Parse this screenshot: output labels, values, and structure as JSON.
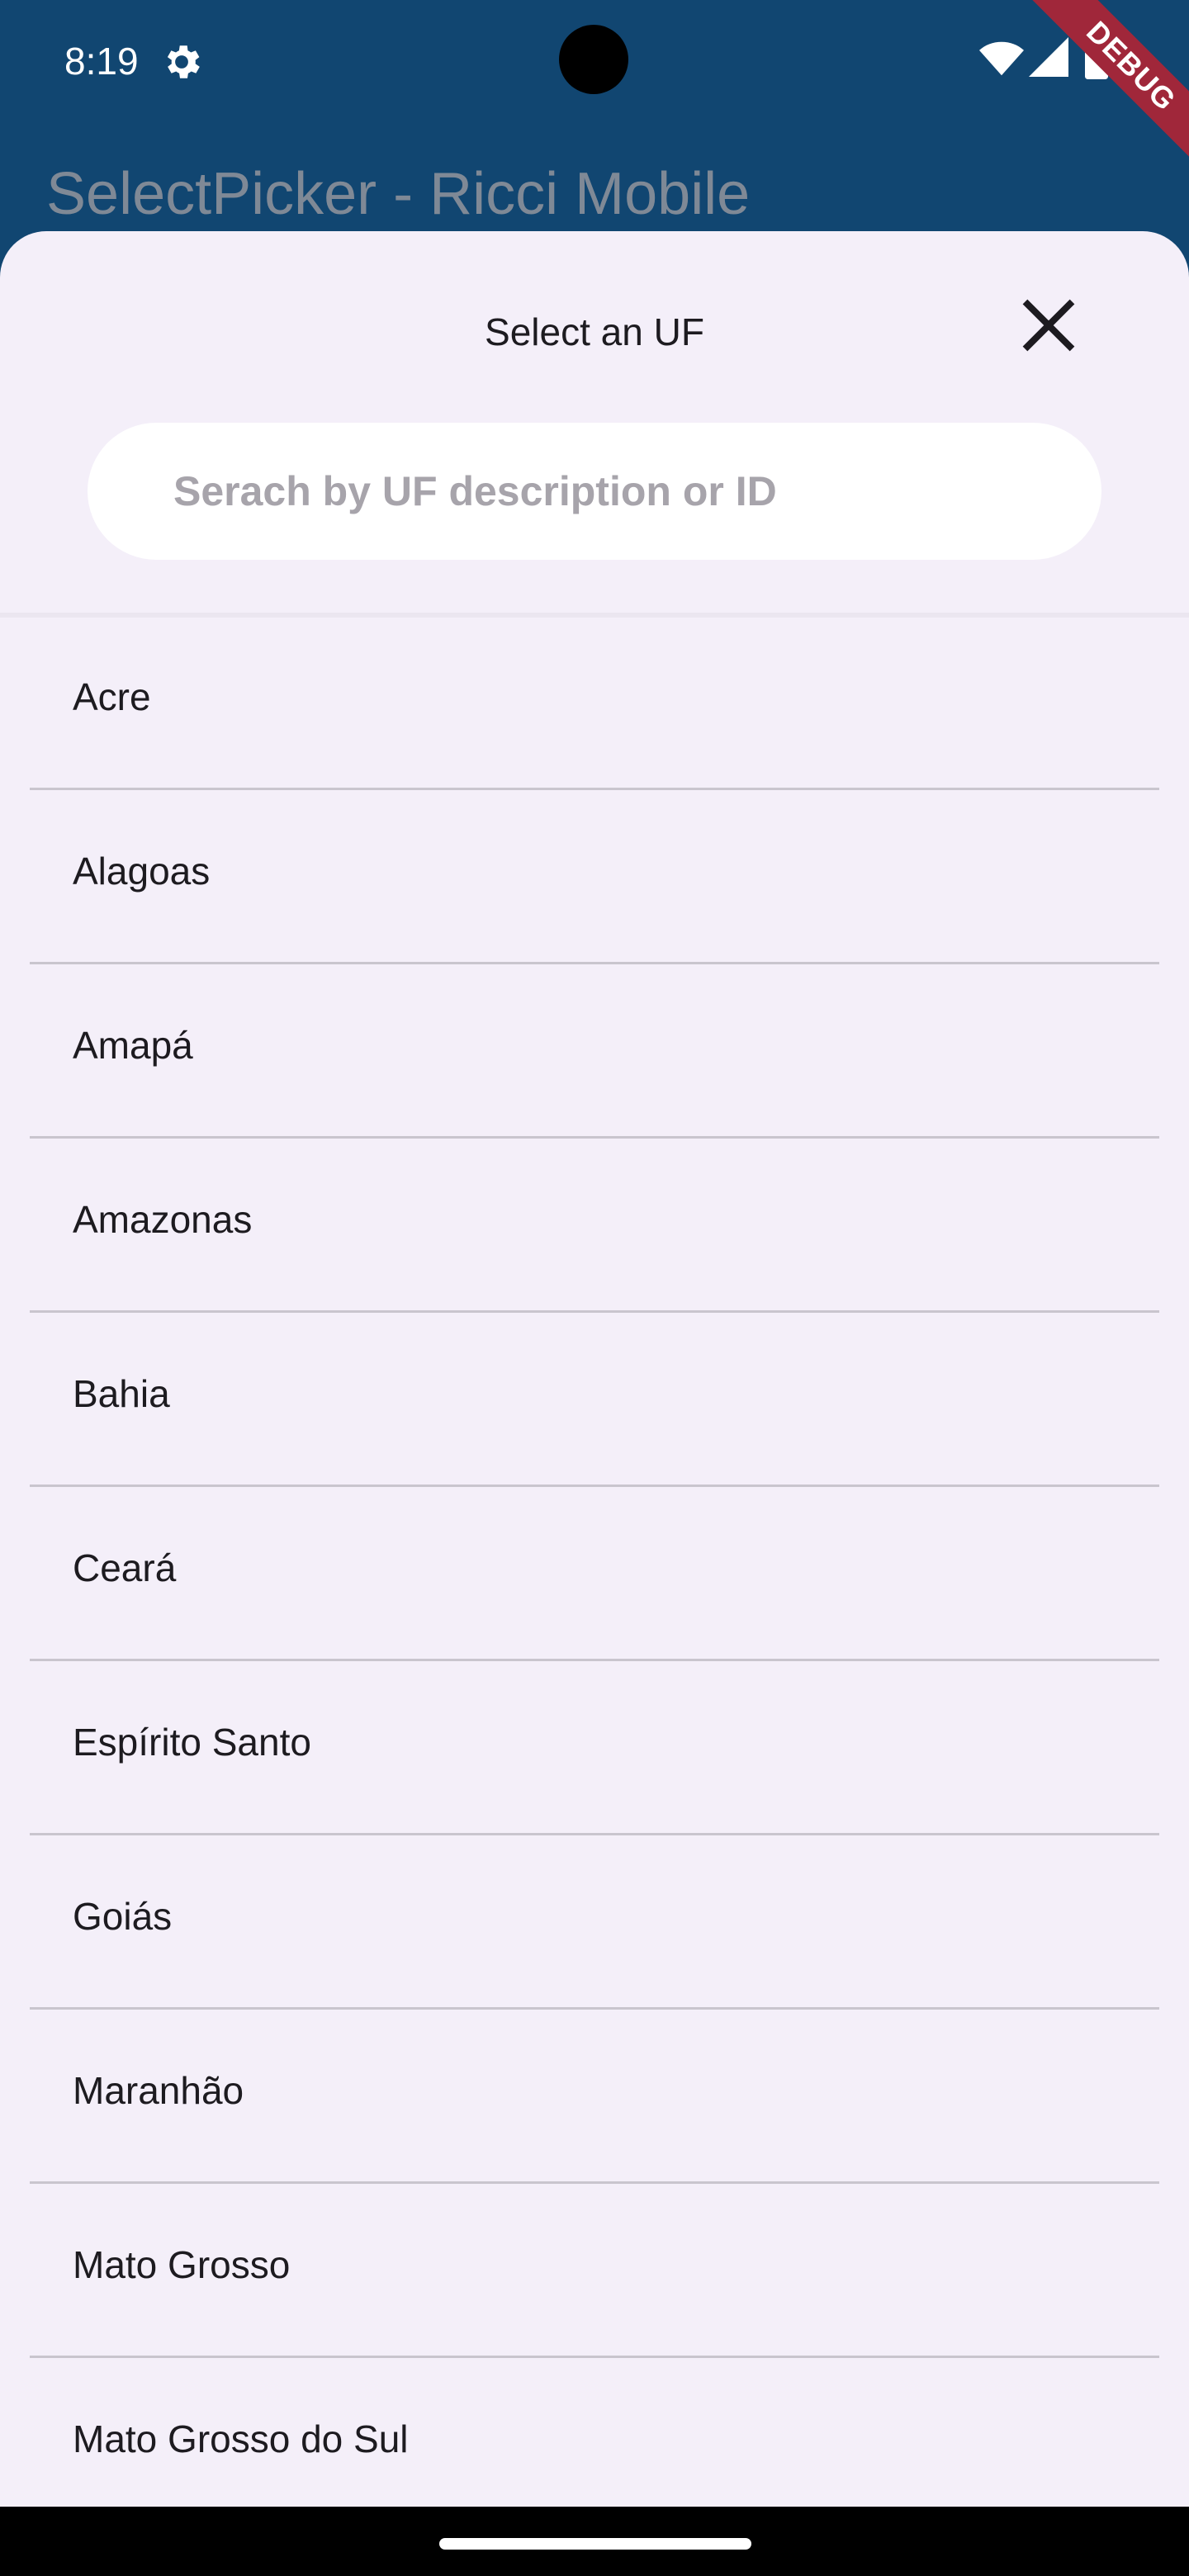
{
  "status_bar": {
    "time": "8:19",
    "icons": [
      "settings-icon",
      "wifi-icon",
      "signal-icon",
      "battery-icon"
    ]
  },
  "debug_banner": "DEBUG",
  "app_bar": {
    "title": "SelectPicker - Ricci Mobile"
  },
  "sheet": {
    "title": "Select an UF",
    "close_icon": "close-icon",
    "search": {
      "value": "",
      "placeholder": "Serach by UF description or ID"
    },
    "items": [
      {
        "label": "Acre"
      },
      {
        "label": "Alagoas"
      },
      {
        "label": "Amapá"
      },
      {
        "label": "Amazonas"
      },
      {
        "label": "Bahia"
      },
      {
        "label": "Ceará"
      },
      {
        "label": "Espírito Santo"
      },
      {
        "label": "Goiás"
      },
      {
        "label": "Maranhão"
      },
      {
        "label": "Mato Grosso"
      },
      {
        "label": "Mato Grosso do Sul"
      }
    ]
  },
  "colors": {
    "app_bar": "#114671",
    "sheet_background": "#f4eff9",
    "search_background": "#ffffff",
    "divider": "#c9c5ce",
    "debug_ribbon": "#a0273a",
    "text_primary": "#1d1b20"
  }
}
